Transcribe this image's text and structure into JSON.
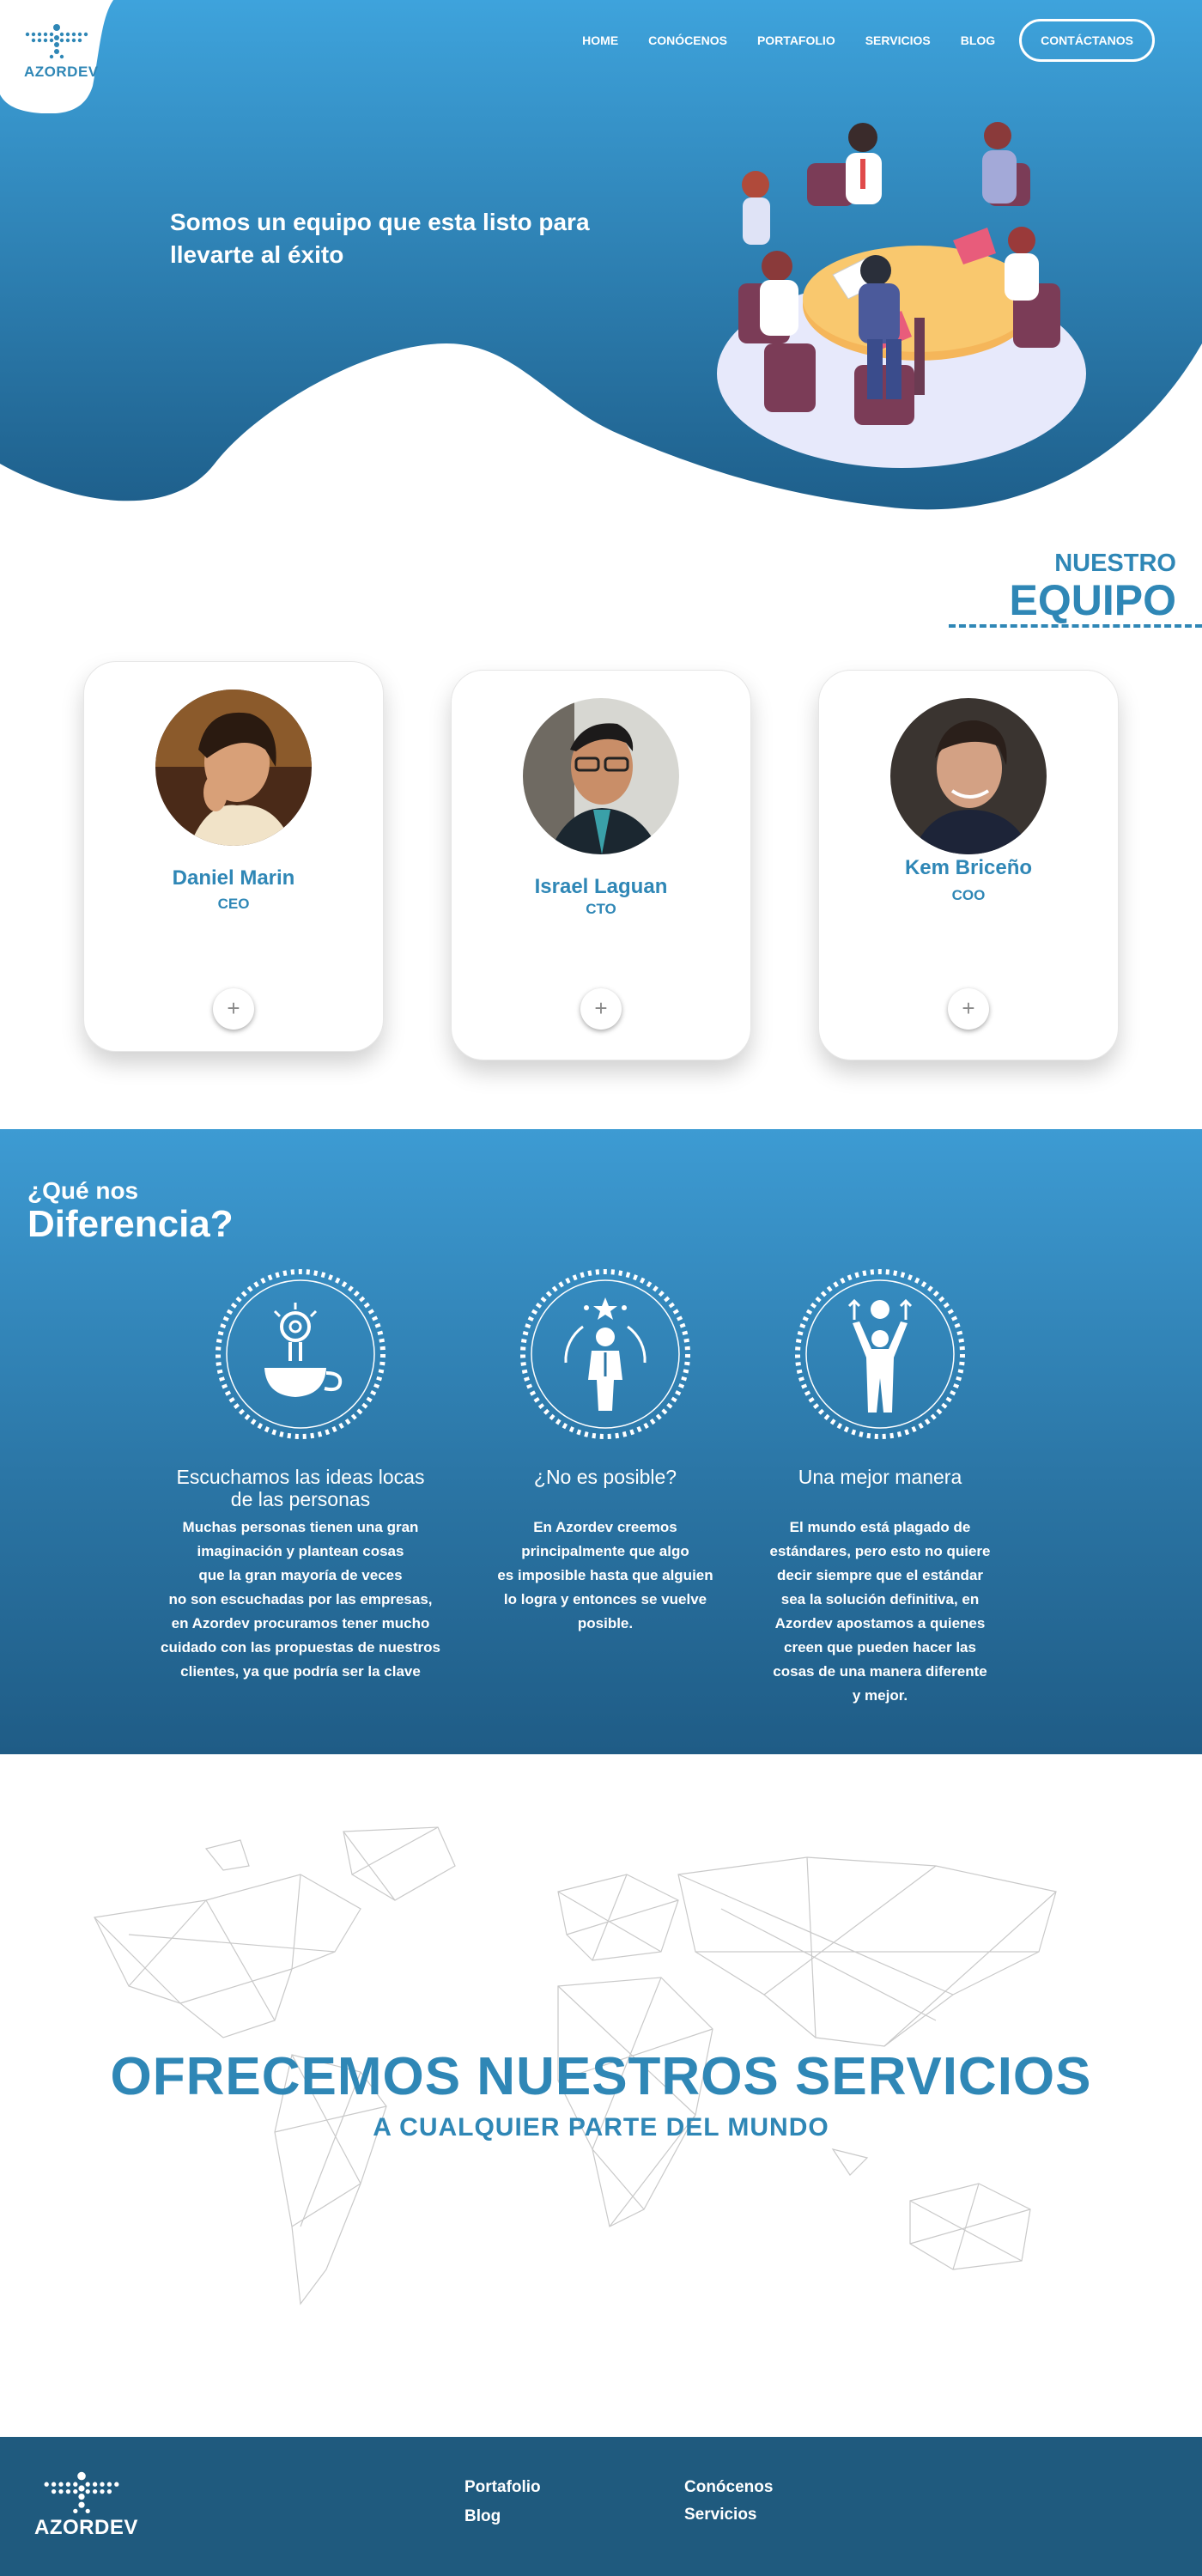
{
  "brand": {
    "name": "AZORDEV"
  },
  "nav": {
    "links": [
      "HOME",
      "CONÓCENOS",
      "PORTAFOLIO",
      "SERVICIOS",
      "BLOG"
    ],
    "cta": "CONTÁCTANOS"
  },
  "hero": {
    "tagline": "Somos un equipo que esta listo para llevarte al éxito"
  },
  "team": {
    "kicker": "NUESTRO",
    "title": "EQUIPO",
    "members": [
      {
        "name": "Daniel Marin",
        "role": "CEO",
        "action": "+"
      },
      {
        "name": "Israel Laguan",
        "role": "CTO",
        "action": "+"
      },
      {
        "name": "Kem Briceño",
        "role": "COO",
        "action": "+"
      }
    ]
  },
  "difference": {
    "kicker": "¿Qué nos",
    "title": "Diferencia?",
    "items": [
      {
        "icon": "idea-coffee-icon",
        "title_lines": [
          "Escuchamos las ideas locas",
          "de las personas"
        ],
        "text_lines": [
          "Muchas personas tienen una gran",
          "imaginación y plantean cosas",
          "que la gran mayoría de veces",
          "no son escuchadas por las empresas,",
          "en Azordev procuramos tener mucho",
          "cuidado con las propuestas de nuestros",
          "clientes, ya que podría ser la clave"
        ]
      },
      {
        "icon": "leader-star-icon",
        "title_lines": [
          "¿No es posible?"
        ],
        "text_lines": [
          "En Azordev creemos",
          "principalmente que algo",
          "es imposible hasta que alguien",
          "lo logra y entonces se vuelve",
          "posible."
        ]
      },
      {
        "icon": "raised-arms-icon",
        "title_lines": [
          "Una mejor manera"
        ],
        "text_lines": [
          "El mundo está plagado de",
          "estándares, pero esto no quiere",
          "decir siempre que el estándar",
          "sea la solución definitiva, en",
          "Azordev apostamos a quienes",
          "creen que pueden hacer las",
          "cosas de una manera diferente",
          "y mejor."
        ]
      }
    ]
  },
  "services": {
    "title": "OFRECEMOS NUESTROS SERVICIOS",
    "subtitle": "A CUALQUIER PARTE DEL MUNDO"
  },
  "footer": {
    "brand": "AZORDEV",
    "links": [
      "Portafolio",
      "Blog",
      "Conócenos",
      "Servicios"
    ]
  },
  "colors": {
    "primary": "#2f87b6",
    "hero_top": "#3ea3dc",
    "hero_bottom": "#1e5f8b",
    "footer": "#1f5a7e"
  }
}
